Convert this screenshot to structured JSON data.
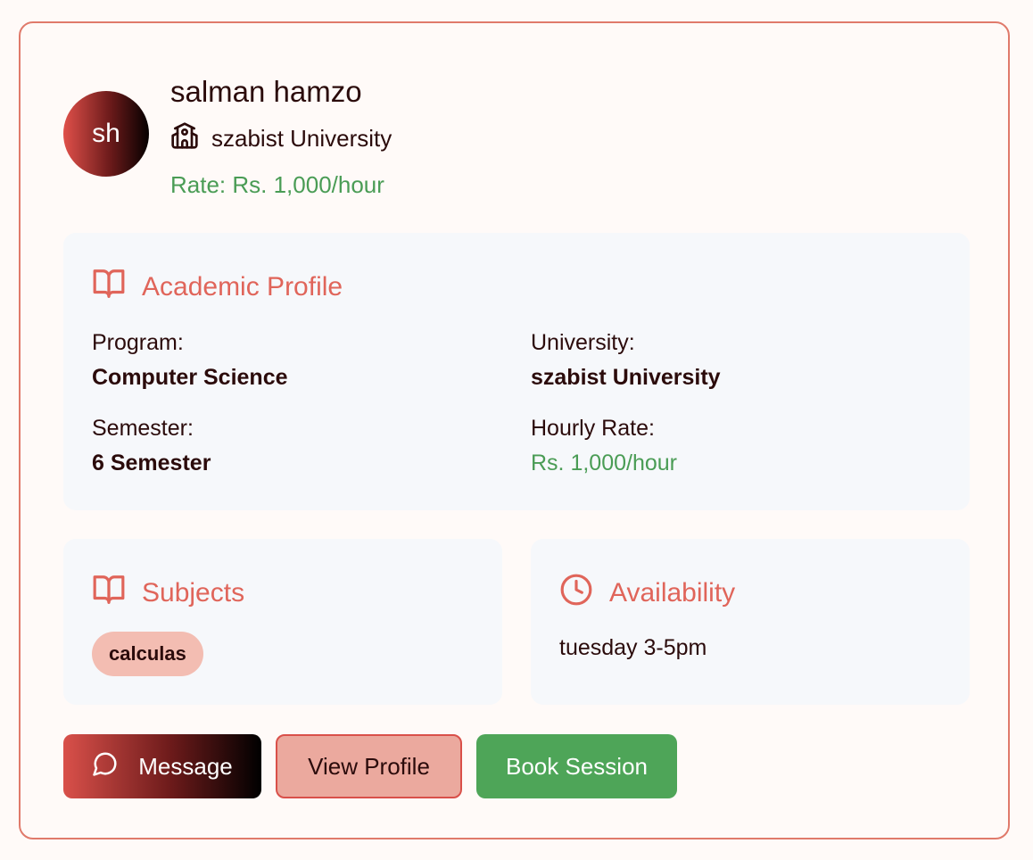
{
  "tutor": {
    "initials": "sh",
    "name": "salman hamzo",
    "university": "szabist University",
    "rate_text": "Rate: Rs. 1,000/hour"
  },
  "academic": {
    "title": "Academic Profile",
    "program_label": "Program:",
    "program_value": "Computer Science",
    "university_label": "University:",
    "university_value": "szabist University",
    "semester_label": "Semester:",
    "semester_value": "6 Semester",
    "rate_label": "Hourly Rate:",
    "rate_value": "Rs. 1,000/hour"
  },
  "subjects": {
    "title": "Subjects",
    "items": [
      "calculas"
    ]
  },
  "availability": {
    "title": "Availability",
    "text": "tuesday 3-5pm"
  },
  "actions": {
    "message": "Message",
    "view_profile": "View Profile",
    "book_session": "Book Session"
  },
  "colors": {
    "accent": "#e0655a",
    "green": "#4a9c55",
    "panel_bg": "#f6f8fb",
    "border": "#e07a6b"
  }
}
